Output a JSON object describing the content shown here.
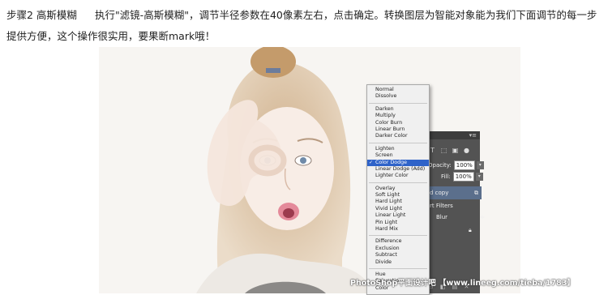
{
  "article": {
    "step_title": "步骤2 高斯模糊",
    "body": "执行\"滤镜-高斯模糊\"，调节半径参数在40像素左右，点击确定。转换图层为智能对象能为我们下面调节的每一步提供方便，这个操作很实用，要果断mark哦！"
  },
  "layers_panel": {
    "opacity_label": "Opacity:",
    "opacity_value": "100%",
    "fill_label": "Fill:",
    "fill_value": "100%",
    "layer_name": "d copy",
    "smart_filters_label": "rt Filters",
    "blur_label": "Blur"
  },
  "blend_menu": {
    "groups": [
      [
        "Normal",
        "Dissolve"
      ],
      [
        "Darken",
        "Multiply",
        "Color Burn",
        "Linear Burn",
        "Darker Color"
      ],
      [
        "Lighten",
        "Screen",
        "Color Dodge",
        "Linear Dodge (Add)",
        "Lighter Color"
      ],
      [
        "Overlay",
        "Soft Light",
        "Hard Light",
        "Vivid Light",
        "Linear Light",
        "Pin Light",
        "Hard Mix"
      ],
      [
        "Difference",
        "Exclusion",
        "Subtract",
        "Divide"
      ],
      [
        "Hue",
        "Saturation",
        "Color"
      ]
    ],
    "selected": "Color Dodge",
    "selected_color": "#2f63c9"
  },
  "watermark": "PhotoShop平面设计吧 【www.lineeg.com/tieba/1783】"
}
